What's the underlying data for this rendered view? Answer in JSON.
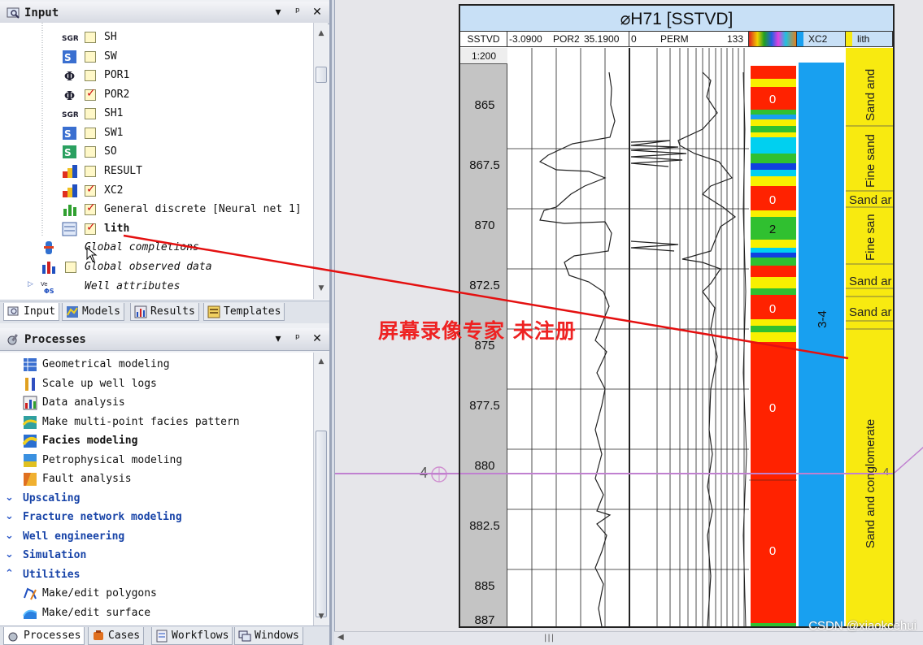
{
  "input_pane": {
    "title": "Input",
    "items": [
      {
        "label": "SH",
        "icon": "sgr-icon",
        "checked": false
      },
      {
        "label": "SW",
        "icon": "sw-icon",
        "checked": false
      },
      {
        "label": "POR1",
        "icon": "phi-icon",
        "checked": false
      },
      {
        "label": "POR2",
        "icon": "phi-icon",
        "checked": true
      },
      {
        "label": "SH1",
        "icon": "sgr-icon",
        "checked": false
      },
      {
        "label": "SW1",
        "icon": "sw-icon",
        "checked": false
      },
      {
        "label": "SO",
        "icon": "so-icon",
        "checked": false
      },
      {
        "label": "RESULT",
        "icon": "property-icon",
        "checked": false
      },
      {
        "label": "XC2",
        "icon": "property-icon",
        "checked": true
      },
      {
        "label": "General discrete [Neural net 1]",
        "icon": "discrete-icon",
        "checked": true
      },
      {
        "label": "lith",
        "icon": "lith-icon",
        "checked": true
      },
      {
        "label": "Global completions",
        "icon": "completions-icon"
      },
      {
        "label": "Global observed data",
        "icon": "observed-data-icon"
      },
      {
        "label": "Well attributes",
        "icon": "well-attributes-icon"
      }
    ]
  },
  "top_tabs": [
    "Input",
    "Models",
    "Results",
    "Templates"
  ],
  "processes_pane": {
    "title": "Processes",
    "items": [
      {
        "label": "Geometrical modeling",
        "type": "item"
      },
      {
        "label": "Scale up well logs",
        "type": "item"
      },
      {
        "label": "Data analysis",
        "type": "item"
      },
      {
        "label": "Make multi-point facies pattern",
        "type": "item"
      },
      {
        "label": "Facies modeling",
        "type": "item",
        "bold": true
      },
      {
        "label": "Petrophysical modeling",
        "type": "item"
      },
      {
        "label": "Fault analysis",
        "type": "item"
      },
      {
        "label": "Upscaling",
        "type": "section",
        "expanded": false
      },
      {
        "label": "Fracture network modeling",
        "type": "section",
        "expanded": false
      },
      {
        "label": "Well engineering",
        "type": "section",
        "expanded": false
      },
      {
        "label": "Simulation",
        "type": "section",
        "expanded": false
      },
      {
        "label": "Utilities",
        "type": "section",
        "expanded": true
      },
      {
        "label": "Make/edit polygons",
        "type": "item"
      },
      {
        "label": "Make/edit surface",
        "type": "item"
      }
    ]
  },
  "bottom_tabs": [
    "Processes",
    "Cases",
    "Workflows",
    "Windows"
  ],
  "well_section": {
    "title": "H71 [SSTVD]",
    "columns": {
      "depth": "SSTVD",
      "por2_min": "-3.0900",
      "por2_name": "POR2",
      "por2_max": "35.1900",
      "perm_min": "0",
      "perm_name": "PERM",
      "perm_max": "133",
      "xc2": "XC2",
      "lith": "lith"
    },
    "scale": "1:200",
    "depth_labels": [
      "865",
      "867.5",
      "870",
      "872.5",
      "875",
      "877.5",
      "880",
      "882.5",
      "885",
      "887"
    ],
    "facies_codes": [
      "0",
      "0",
      "2",
      "0",
      "0",
      "0"
    ],
    "xc2_label": "3-4",
    "lith_labels": [
      "Sand and",
      "Fine sand",
      "Sand ar",
      "Fine san",
      "Sand ar",
      "Sand ar",
      "Sand and conglomerate"
    ],
    "marker": {
      "label": "4",
      "right_label": "4",
      "color": "#c080d0"
    }
  },
  "watermark": "屏幕录像专家  未注册",
  "credit": "CSDN @xiaokcehui",
  "colors": {
    "facies_red": "#ff2200",
    "facies_yellow": "#f8f000",
    "xc2_blue": "#18a0f0",
    "lith_yellow": "#f8ea10",
    "annotation_red": "#e41010"
  }
}
